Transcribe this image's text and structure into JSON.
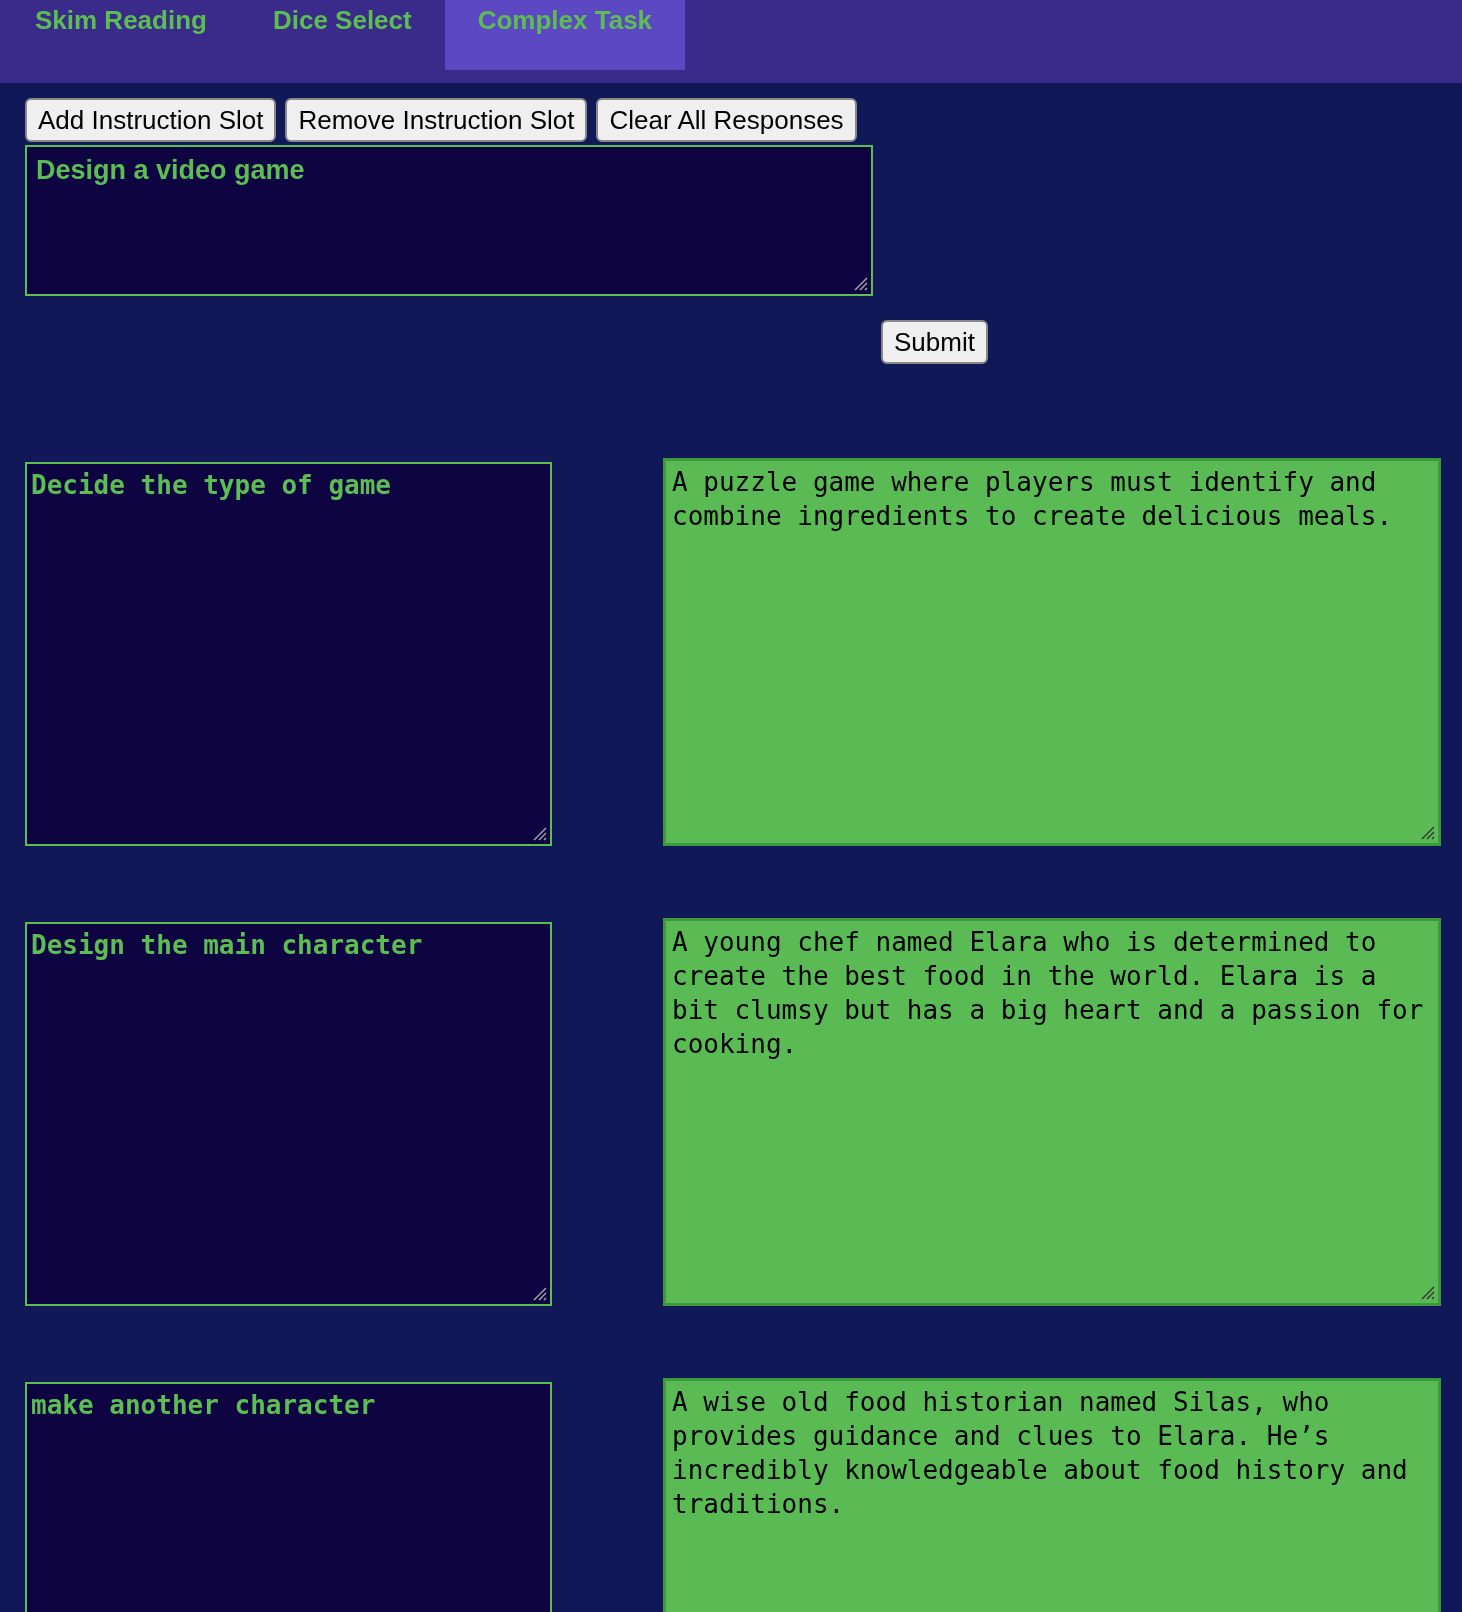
{
  "tabs": [
    {
      "label": "Skim Reading",
      "selected": false
    },
    {
      "label": "Dice Select",
      "selected": false
    },
    {
      "label": "Complex Task",
      "selected": true
    }
  ],
  "buttons": [
    "Add Instruction Slot",
    "Remove Instruction Slot",
    "Clear All Responses"
  ],
  "task": {
    "value": "Design a video game"
  },
  "submit": "Submit",
  "steps": [
    {
      "instruction": "Decide the type of game",
      "response": "A puzzle game where players must identify and combine ingredients to create delicious meals."
    },
    {
      "instruction": "Design the main character",
      "response": "A young chef named Elara who is determined to create the best food in the world. Elara is a bit clumsy but has a big heart and a passion for cooking."
    },
    {
      "instruction": "make another character",
      "response": "A wise old food historian named Silas, who provides guidance and clues to Elara. He’s incredibly knowledgeable about food history and traditions."
    }
  ]
}
